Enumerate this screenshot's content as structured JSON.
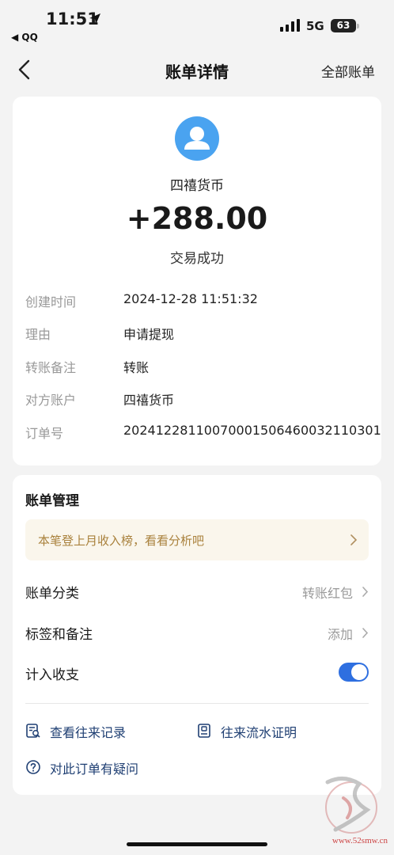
{
  "status_bar": {
    "time": "11:51",
    "back_app": "◀ QQ",
    "network": "5G",
    "battery": "63"
  },
  "nav": {
    "title": "账单详情",
    "right": "全部账单"
  },
  "bill": {
    "name": "四禧货币",
    "amount": "+288.00",
    "status": "交易成功",
    "details": [
      {
        "label": "创建时间",
        "value": "2024-12-28 11:51:32"
      },
      {
        "label": "理由",
        "value": "申请提现"
      },
      {
        "label": "转账备注",
        "value": "转账"
      },
      {
        "label": "对方账户",
        "value": "四禧货币"
      },
      {
        "label": "订单号",
        "value": "20241228110070001506460032110301"
      }
    ]
  },
  "management": {
    "title": "账单管理",
    "tip": "本笔登上月收入榜，看看分析吧",
    "category_label": "账单分类",
    "category_value": "转账红包",
    "tags_label": "标签和备注",
    "tags_value": "添加",
    "include_label": "计入收支",
    "include_on": true,
    "link_records": "查看往来记录",
    "link_proof": "往来流水证明",
    "link_question": "对此订单有疑问"
  },
  "watermark": {
    "url": "www.52smw.cn"
  },
  "colors": {
    "accent": "#2e6fe0",
    "link": "#1f3f73",
    "tip_text": "#a9813c",
    "avatar": "#4aa3f0"
  }
}
